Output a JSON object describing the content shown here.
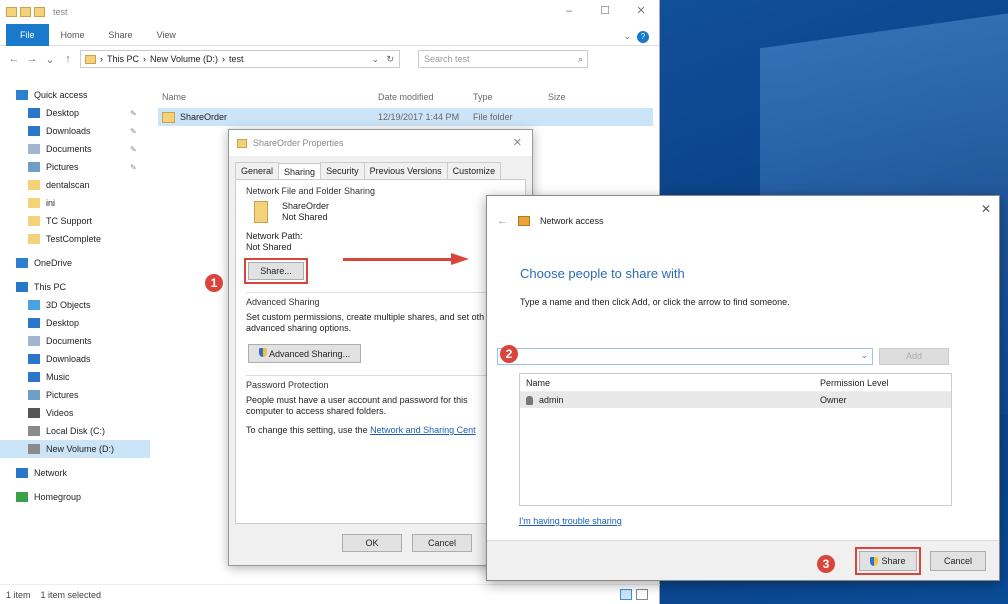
{
  "explorer": {
    "title": "test",
    "ribbon_tabs": [
      "File",
      "Home",
      "Share",
      "View"
    ],
    "breadcrumb": [
      "This PC",
      "New Volume (D:)",
      "test"
    ],
    "search_placeholder": "Search test",
    "columns": [
      "Name",
      "Date modified",
      "Type",
      "Size"
    ],
    "file": {
      "name": "ShareOrder",
      "date": "12/19/2017 1:44 PM",
      "type": "File folder"
    },
    "status": {
      "count": "1 item",
      "selected": "1 item selected"
    },
    "nav": [
      {
        "label": "Quick access",
        "icon": "star-icon",
        "color": "#2f7fd1"
      },
      {
        "label": "Desktop",
        "icon": "desktop-icon",
        "color": "#2a77c9"
      },
      {
        "label": "Downloads",
        "icon": "download-icon",
        "color": "#2a77c9"
      },
      {
        "label": "Documents",
        "icon": "document-icon",
        "color": "#9fb6cc"
      },
      {
        "label": "Pictures",
        "icon": "picture-icon",
        "color": "#6f9fc6"
      },
      {
        "label": "dentalscan",
        "icon": "folder-icon",
        "color": "#f3d27a"
      },
      {
        "label": "ini",
        "icon": "folder-icon",
        "color": "#f3d27a"
      },
      {
        "label": "TC Support",
        "icon": "folder-icon",
        "color": "#f3d27a"
      },
      {
        "label": "TestComplete",
        "icon": "folder-icon",
        "color": "#f3d27a"
      },
      {
        "label": "OneDrive",
        "icon": "cloud-icon",
        "color": "#2f7fd1"
      },
      {
        "label": "This PC",
        "icon": "computer-icon",
        "color": "#2a77c9"
      },
      {
        "label": "3D Objects",
        "icon": "cube-icon",
        "color": "#4aa3e0"
      },
      {
        "label": "Desktop",
        "icon": "desktop-icon",
        "color": "#2a77c9"
      },
      {
        "label": "Documents",
        "icon": "document-icon",
        "color": "#9fb6cc"
      },
      {
        "label": "Downloads",
        "icon": "download-icon",
        "color": "#2a77c9"
      },
      {
        "label": "Music",
        "icon": "music-icon",
        "color": "#2a77c9"
      },
      {
        "label": "Pictures",
        "icon": "picture-icon",
        "color": "#6f9fc6"
      },
      {
        "label": "Videos",
        "icon": "video-icon",
        "color": "#555555"
      },
      {
        "label": "Local Disk (C:)",
        "icon": "drive-icon",
        "color": "#8a8a8a"
      },
      {
        "label": "New Volume (D:)",
        "icon": "drive-icon",
        "color": "#8a8a8a"
      },
      {
        "label": "Network",
        "icon": "network-icon",
        "color": "#2a77c9"
      },
      {
        "label": "Homegroup",
        "icon": "homegroup-icon",
        "color": "#3aa14a"
      }
    ]
  },
  "properties": {
    "title": "ShareOrder Properties",
    "tabs": [
      "General",
      "Sharing",
      "Security",
      "Previous Versions",
      "Customize"
    ],
    "nfs_title": "Network File and Folder Sharing",
    "folder_name": "ShareOrder",
    "folder_state": "Not Shared",
    "path_label": "Network Path:",
    "path_value": "Not Shared",
    "share_btn": "Share...",
    "adv_title": "Advanced Sharing",
    "adv_desc1": "Set custom permissions, create multiple shares, and set oth",
    "adv_desc2": "advanced sharing options.",
    "adv_btn": "Advanced Sharing...",
    "pw_title": "Password Protection",
    "pw_desc1": "People must have a user account and password for this",
    "pw_desc2": "computer to access shared folders.",
    "pw_change": "To change this setting, use the",
    "pw_link": "Network and Sharing Cent",
    "ok": "OK",
    "cancel": "Cancel"
  },
  "network_access": {
    "title": "Network access",
    "heading": "Choose people to share with",
    "instruction": "Type a name and then click Add, or click the arrow to find someone.",
    "add_btn": "Add",
    "col_name": "Name",
    "col_perm": "Permission Level",
    "user_name": "admin",
    "user_perm": "Owner",
    "trouble_link": "I'm having trouble sharing",
    "share_btn": "Share",
    "cancel_btn": "Cancel"
  },
  "steps": [
    "1",
    "2",
    "3"
  ],
  "accent": "#d9453a"
}
